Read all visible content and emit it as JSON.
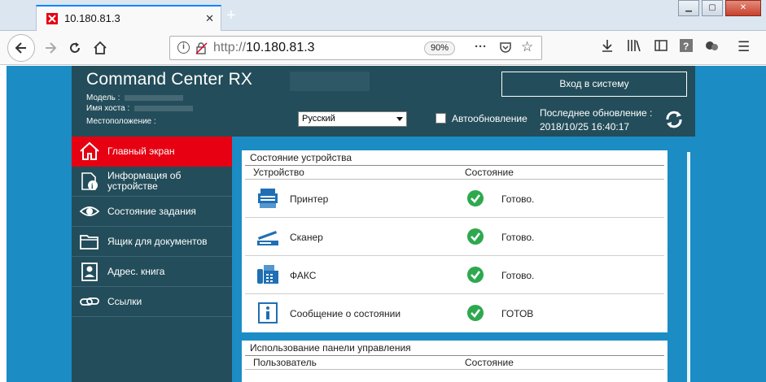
{
  "browser": {
    "tab_title": "10.180.81.3",
    "url_protocol": "http://",
    "url_host": "10.180.81.3",
    "zoom": "90%",
    "new_tab_symbol": "+"
  },
  "header": {
    "brand": "Command Center RX",
    "model_label": "Модель :",
    "host_label": "Имя хоста :",
    "location_label": "Местоположение :",
    "language": "Русский",
    "auto_refresh_label": "Автообновление",
    "login_button": "Вход в систему",
    "last_update_label": "Последнее обновление :",
    "last_update_time": "2018/10/25 16:40:17"
  },
  "sidebar": {
    "items": [
      {
        "label": "Главный экран",
        "icon": "home-icon"
      },
      {
        "label": "Информация об устройстве",
        "icon": "device-info-icon"
      },
      {
        "label": "Состояние задания",
        "icon": "eye-icon"
      },
      {
        "label": "Ящик для документов",
        "icon": "folder-icon"
      },
      {
        "label": "Адрес. книга",
        "icon": "address-book-icon"
      },
      {
        "label": "Ссылки",
        "icon": "link-icon"
      }
    ]
  },
  "device_status": {
    "title": "Состояние устройства",
    "col_device": "Устройство",
    "col_status": "Состояние",
    "rows": [
      {
        "name": "Принтер",
        "status": "Готово.",
        "icon": "printer-icon"
      },
      {
        "name": "Сканер",
        "status": "Готово.",
        "icon": "scanner-icon"
      },
      {
        "name": "ФАКС",
        "status": "Готово.",
        "icon": "fax-icon"
      },
      {
        "name": "Сообщение о состоянии",
        "status": "ГОТОВ",
        "icon": "info-icon"
      }
    ]
  },
  "panel_usage": {
    "title": "Использование панели управления",
    "col_user": "Пользователь",
    "col_status": "Состояние"
  },
  "colors": {
    "page_bg": "#1b8cc4",
    "header_bg": "#234d5a",
    "active_nav": "#e60012",
    "status_ok": "#2ea84f"
  }
}
